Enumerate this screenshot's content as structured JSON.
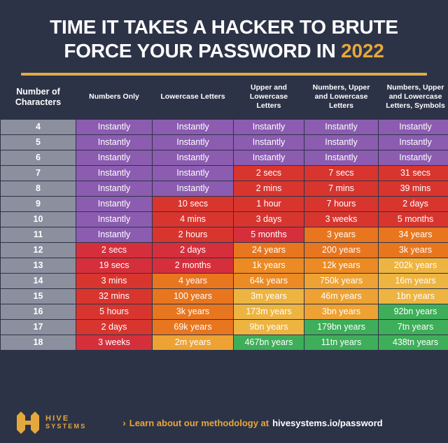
{
  "header": {
    "title_line1": "TIME IT TAKES A HACKER TO BRUTE",
    "title_line2_pre": "FORCE YOUR PASSWORD IN",
    "title_year": "2022",
    "accent_color": "#e0ab46"
  },
  "table": {
    "columns": [
      "Number of Characters",
      "Numbers Only",
      "Lowercase Letters",
      "Upper and Lowercase Letters",
      "Numbers, Upper and Lowercase Letters",
      "Numbers, Upper and Lowercase Letters, Symbols"
    ],
    "rows": [
      {
        "chars": "4",
        "cells": [
          "Instantly",
          "Instantly",
          "Instantly",
          "Instantly",
          "Instantly"
        ],
        "colors": [
          "sw-purple",
          "sw-purple",
          "sw-purple",
          "sw-purple",
          "sw-purple"
        ]
      },
      {
        "chars": "5",
        "cells": [
          "Instantly",
          "Instantly",
          "Instantly",
          "Instantly",
          "Instantly"
        ],
        "colors": [
          "sw-purple",
          "sw-purple",
          "sw-purple",
          "sw-purple",
          "sw-purple"
        ]
      },
      {
        "chars": "6",
        "cells": [
          "Instantly",
          "Instantly",
          "Instantly",
          "Instantly",
          "Instantly"
        ],
        "colors": [
          "sw-purple",
          "sw-purple",
          "sw-purple",
          "sw-purple",
          "sw-purple"
        ]
      },
      {
        "chars": "7",
        "cells": [
          "Instantly",
          "Instantly",
          "2 secs",
          "7 secs",
          "31 secs"
        ],
        "colors": [
          "sw-purple",
          "sw-purple",
          "sw-red",
          "sw-red",
          "sw-red"
        ]
      },
      {
        "chars": "8",
        "cells": [
          "Instantly",
          "Instantly",
          "2 mins",
          "7 mins",
          "39 mins"
        ],
        "colors": [
          "sw-purple",
          "sw-purple",
          "sw-red",
          "sw-red",
          "sw-red"
        ]
      },
      {
        "chars": "9",
        "cells": [
          "Instantly",
          "10 secs",
          "1 hour",
          "7 hours",
          "2 days"
        ],
        "colors": [
          "sw-purple",
          "sw-red",
          "sw-red",
          "sw-red",
          "sw-red"
        ]
      },
      {
        "chars": "10",
        "cells": [
          "Instantly",
          "4 mins",
          "3 days",
          "3 weeks",
          "5 months"
        ],
        "colors": [
          "sw-purple",
          "sw-red",
          "sw-red",
          "sw-red",
          "sw-red"
        ]
      },
      {
        "chars": "11",
        "cells": [
          "Instantly",
          "2 hours",
          "5 months",
          "3 years",
          "34 years"
        ],
        "colors": [
          "sw-purple",
          "sw-red",
          "sw-crimson",
          "sw-orange",
          "sw-orange"
        ]
      },
      {
        "chars": "12",
        "cells": [
          "2 secs",
          "2 days",
          "24 years",
          "200 years",
          "3k years"
        ],
        "colors": [
          "sw-crimson",
          "sw-crimson",
          "sw-orange",
          "sw-orange",
          "sw-orange"
        ]
      },
      {
        "chars": "13",
        "cells": [
          "19 secs",
          "2 months",
          "1k years",
          "12k years",
          "202k years"
        ],
        "colors": [
          "sw-crimson",
          "sw-crimson",
          "sw-orange2",
          "sw-orange2",
          "sw-amber2"
        ]
      },
      {
        "chars": "14",
        "cells": [
          "3 mins",
          "4 years",
          "64k years",
          "750k years",
          "16m years"
        ],
        "colors": [
          "sw-red",
          "sw-orange",
          "sw-orange2",
          "sw-amber",
          "sw-amber2"
        ]
      },
      {
        "chars": "15",
        "cells": [
          "32 mins",
          "100 years",
          "3m years",
          "46m years",
          "1bn years"
        ],
        "colors": [
          "sw-red",
          "sw-orange",
          "sw-amber2",
          "sw-amber",
          "sw-amber2"
        ]
      },
      {
        "chars": "16",
        "cells": [
          "5 hours",
          "3k years",
          "173m years",
          "3bn years",
          "92bn years"
        ],
        "colors": [
          "sw-red",
          "sw-orange",
          "sw-amber2",
          "sw-amber",
          "sw-green"
        ]
      },
      {
        "chars": "17",
        "cells": [
          "2 days",
          "69k years",
          "9bn years",
          "179bn years",
          "7tn years"
        ],
        "colors": [
          "sw-red",
          "sw-orange",
          "sw-amber2",
          "sw-green",
          "sw-green"
        ]
      },
      {
        "chars": "18",
        "cells": [
          "3 weeks",
          "2m years",
          "467bn years",
          "11tn years",
          "438tn years"
        ],
        "colors": [
          "sw-crimson",
          "sw-amber",
          "sw-green",
          "sw-green",
          "sw-green"
        ]
      }
    ]
  },
  "footer": {
    "logo_line1": "HIVE",
    "logo_line2": "SYSTEMS",
    "cta_chevron": "›",
    "cta_lead": "Learn about our methodology at",
    "cta_url": "hivesystems.io/password"
  }
}
